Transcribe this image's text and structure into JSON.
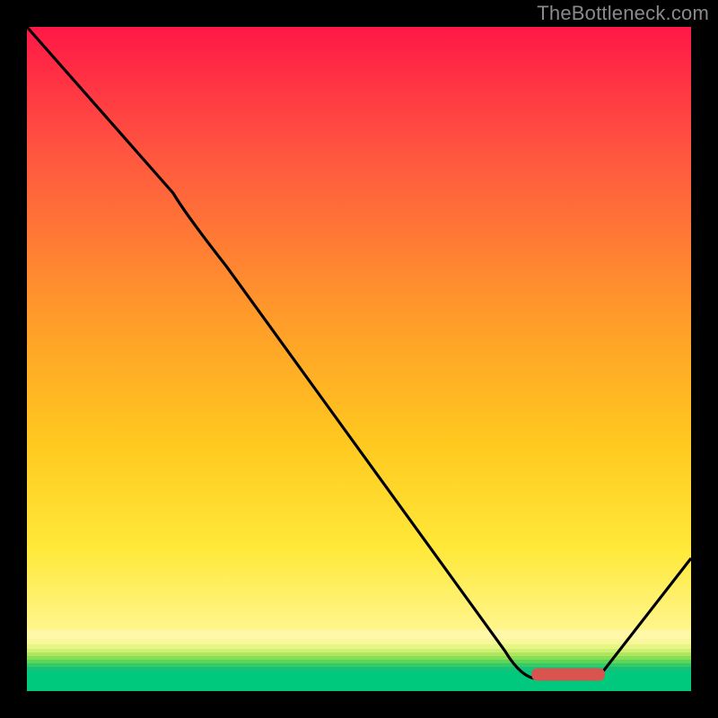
{
  "watermark": "TheBottleneck.com",
  "colors": {
    "gradient_stops": [
      {
        "offset": "0%",
        "color": "#ff1846"
      },
      {
        "offset": "20%",
        "color": "#ff5640"
      },
      {
        "offset": "45%",
        "color": "#ff9a2a"
      },
      {
        "offset": "65%",
        "color": "#ffc81f"
      },
      {
        "offset": "82%",
        "color": "#ffe93a"
      },
      {
        "offset": "100%",
        "color": "#fffbb0"
      }
    ],
    "green_base": "#00c97e",
    "marker": "#d9534f",
    "curve": "#000000",
    "page_bg": "#000000",
    "watermark": "#8a8a8a"
  },
  "chart_data": {
    "type": "line",
    "title": "",
    "xlabel": "",
    "ylabel": "",
    "xlim": [
      0,
      100
    ],
    "ylim": [
      0,
      100
    ],
    "annotations": [
      "TheBottleneck.com"
    ],
    "curve_points": [
      {
        "x": 0,
        "y": 100
      },
      {
        "x": 22,
        "y": 75
      },
      {
        "x": 30,
        "y": 64
      },
      {
        "x": 72,
        "y": 6
      },
      {
        "x": 78,
        "y": 2
      },
      {
        "x": 86,
        "y": 2
      },
      {
        "x": 100,
        "y": 20
      }
    ],
    "optimal_zone": {
      "x_start": 76,
      "x_end": 87,
      "y": 2.5
    },
    "gradient_breakpoints_pct": [
      0,
      20,
      45,
      65,
      82,
      100
    ]
  }
}
